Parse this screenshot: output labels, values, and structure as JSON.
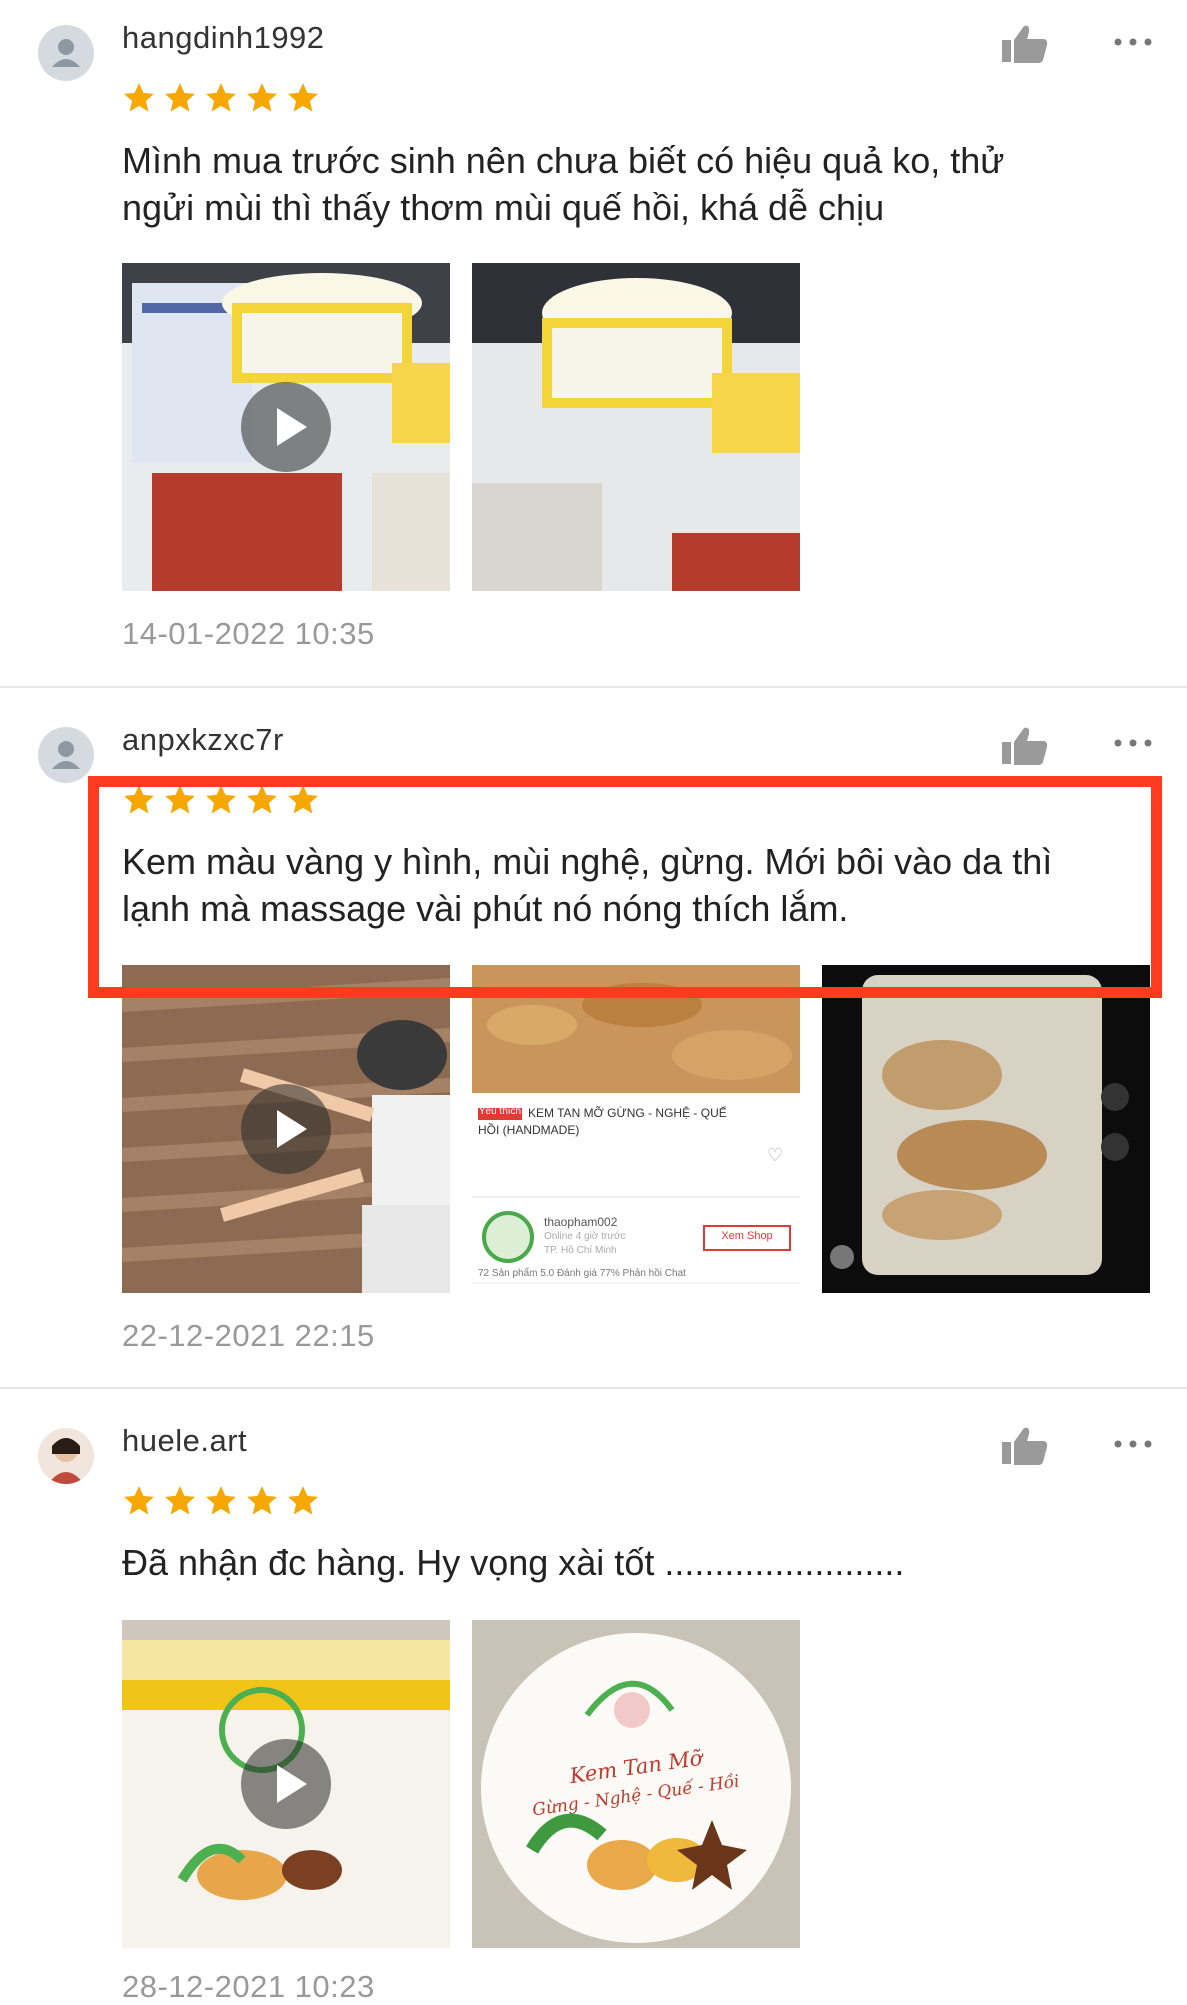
{
  "reviews": [
    {
      "username": "hangdinh1992",
      "rating": 5,
      "comment_line1": "Mình mua trước sinh nên chưa biết có hiệu quả ko,  thử",
      "comment_line2": "ngửi mùi thì thấy thơm mùi quế hồi, khá dễ chịu",
      "timestamp": "14-01-2022 10:35",
      "media": [
        "video",
        "image"
      ]
    },
    {
      "username": "anpxkzxc7r",
      "rating": 5,
      "comment_line1": "Kem màu vàng y hình, mùi nghệ, gừng. Mới bôi vào da thì",
      "comment_line2": "lạnh mà massage vài phút nó nóng thích lắm.",
      "timestamp": "22-12-2021 22:15",
      "media": [
        "video",
        "image",
        "image"
      ],
      "screenshot_text": {
        "badge": "Yêu thích",
        "product_title": "KEM TAN MỠ GỪNG - NGHỆ - QUẾ",
        "product_subtitle": "HỒI (HANDMADE)",
        "shop_name": "thaopham002",
        "shop_status": "Online 4 giờ trước",
        "shop_location": "TP. Hồ Chí Minh",
        "shop_button": "Xem Shop",
        "stats": "72 Sản phẩm   5.0 Đánh giá   77% Phản hồi Chat"
      }
    },
    {
      "username": "huele.art",
      "rating": 5,
      "comment_line1": "Đã nhận đc hàng. Hy vọng xài tốt ........................",
      "comment_line2": "",
      "timestamp": "28-12-2021 10:23",
      "media": [
        "video",
        "image"
      ],
      "jar_label_line1": "Kem Tan Mỡ",
      "jar_label_line2": "Gừng - Nghệ - Quế - Hồi"
    }
  ],
  "colors": {
    "star": "#f6a700",
    "highlight": "#ff3b1f",
    "timestamp": "#999999",
    "icon": "#9a9a9a"
  }
}
